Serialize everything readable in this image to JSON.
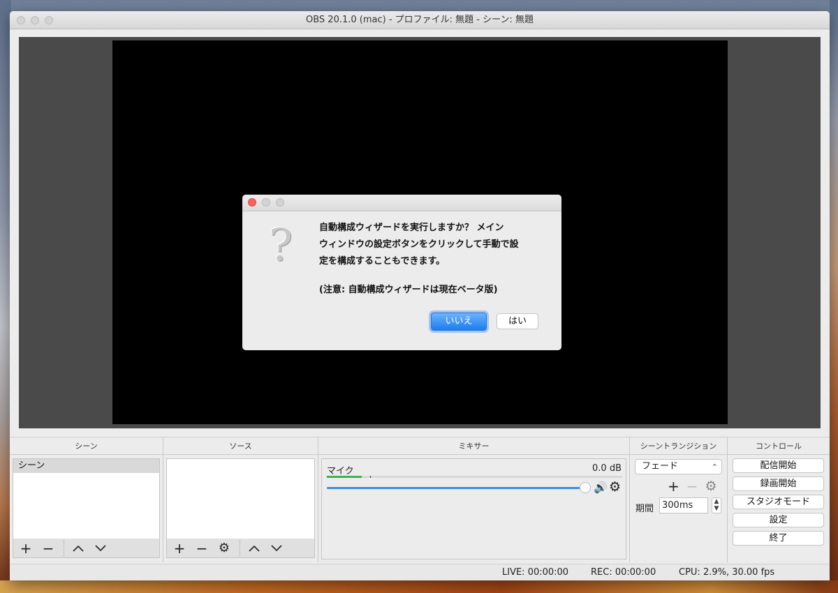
{
  "window": {
    "title": "OBS 20.1.0 (mac) - プロファイル: 無題 - シーン: 無題"
  },
  "dialog": {
    "message_line1": "自動構成ウィザードを実行しますか？ メイン",
    "message_line2": "ウィンドウの設定ボタンをクリックして手動で設",
    "message_line3": "定を構成することもできます。",
    "note": "(注意: 自動構成ウィザードは現在ベータ版)",
    "no_label": "いいえ",
    "yes_label": "はい",
    "icon": "question-icon"
  },
  "docks": {
    "scenes": {
      "title": "シーン",
      "items": [
        "シーン"
      ]
    },
    "sources": {
      "title": "ソース"
    },
    "mixer": {
      "title": "ミキサー",
      "channel_name": "マイク",
      "channel_db": "0.0 dB",
      "volume_level": 1.0
    },
    "transitions": {
      "title": "シーントランジション",
      "selected": "フェード",
      "duration_label": "期間",
      "duration_value": "300ms"
    },
    "controls": {
      "title": "コントロール",
      "buttons": [
        "配信開始",
        "録画開始",
        "スタジオモード",
        "設定",
        "終了"
      ]
    }
  },
  "status": {
    "live": "LIVE: 00:00:00",
    "rec": "REC: 00:00:00",
    "cpu": "CPU: 2.9%, 30.00 fps"
  },
  "colors": {
    "dialog_close": "#fc605c",
    "primary_button": "#1d7cf1",
    "meter_green": "#3bb54a",
    "volume_blue": "#3a8ee6"
  }
}
